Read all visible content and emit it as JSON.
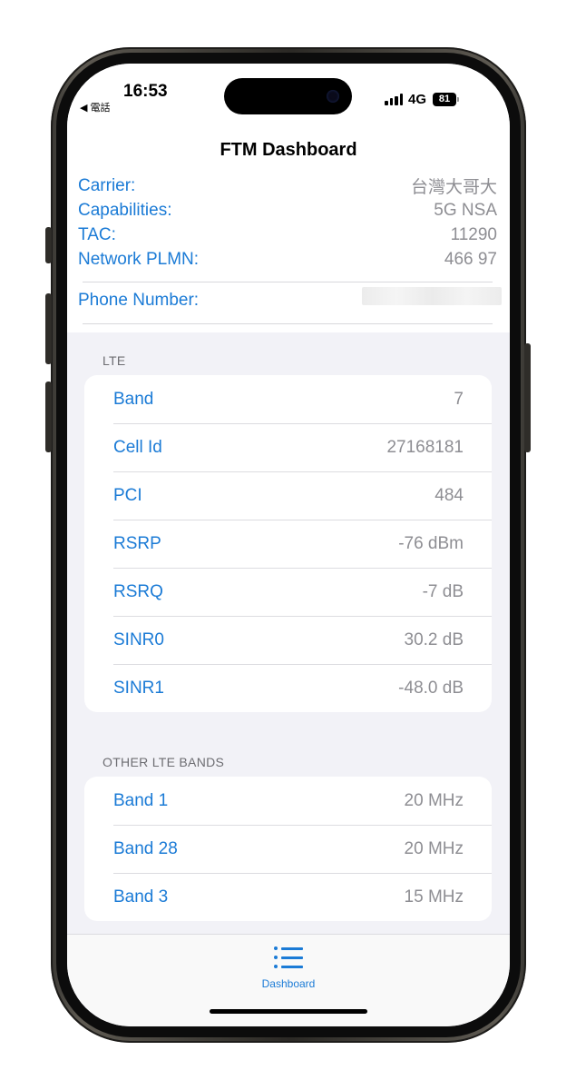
{
  "status_bar": {
    "time": "16:53",
    "back_label": "◀ 電話",
    "network": "4G",
    "battery": "81"
  },
  "nav": {
    "title": "FTM Dashboard"
  },
  "info": {
    "carrier_label": "Carrier:",
    "carrier_value": "台灣大哥大",
    "capabilities_label": "Capabilities:",
    "capabilities_value": "5G NSA",
    "tac_label": "TAC:",
    "tac_value": "11290",
    "plmn_label": "Network PLMN:",
    "plmn_value": "466 97",
    "phone_label": "Phone Number:"
  },
  "lte": {
    "header": "LTE",
    "rows": [
      {
        "label": "Band",
        "value": "7"
      },
      {
        "label": "Cell Id",
        "value": "27168181"
      },
      {
        "label": "PCI",
        "value": "484"
      },
      {
        "label": "RSRP",
        "value": "-76 dBm"
      },
      {
        "label": "RSRQ",
        "value": "-7 dB"
      },
      {
        "label": "SINR0",
        "value": "30.2 dB"
      },
      {
        "label": "SINR1",
        "value": "-48.0 dB"
      }
    ]
  },
  "other_bands": {
    "header": "OTHER LTE BANDS",
    "rows": [
      {
        "label": "Band 1",
        "value": "20 MHz"
      },
      {
        "label": "Band 28",
        "value": "20 MHz"
      },
      {
        "label": "Band 3",
        "value": "15 MHz"
      }
    ]
  },
  "tab_bar": {
    "dashboard_label": "Dashboard"
  },
  "colors": {
    "accent": "#1b7bd6",
    "secondary_text": "#8e8e93",
    "grouped_background": "#f2f2f7"
  }
}
